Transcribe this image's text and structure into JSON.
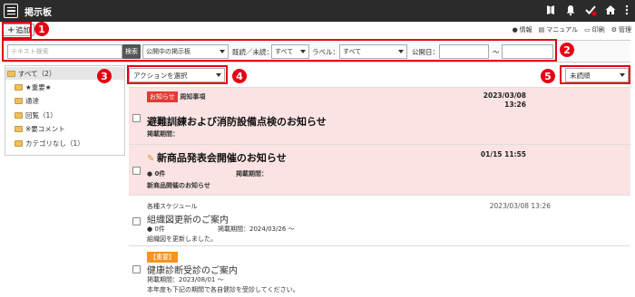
{
  "app": {
    "title": "掲示板"
  },
  "toolbar": {
    "add_label": "追加"
  },
  "links": [
    {
      "label": "情報",
      "icon": "info-icon"
    },
    {
      "label": "マニュアル",
      "icon": "book-icon"
    },
    {
      "label": "印刷",
      "icon": "printer-icon"
    },
    {
      "label": "管理",
      "icon": "gear-icon"
    }
  ],
  "filter": {
    "search_placeholder": "テキスト検索",
    "search_button": "検索",
    "scope": "公開中の掲示板",
    "read_label": "既読／未読：",
    "read_value": "すべて",
    "label_label": "ラベル：",
    "label_value": "すべて",
    "date_label": "公開日：",
    "date_sep": "～"
  },
  "tree": [
    {
      "label": "すべて（2）"
    },
    {
      "label": "★重要★"
    },
    {
      "label": "通達"
    },
    {
      "label": "回覧（1）"
    },
    {
      "label": "※要コメント"
    },
    {
      "label": "カテゴリなし（1）"
    }
  ],
  "action_select": "アクションを選択",
  "sort_select": "未読順",
  "badges": [
    "1",
    "2",
    "3",
    "4",
    "5"
  ],
  "posts": {
    "p1": {
      "tag": "お知らせ",
      "category": "周知事項",
      "date": "2023/03/08",
      "time": "13:26",
      "title": "避難訓練および消防設備点検のお知らせ",
      "period": "掲載期間："
    },
    "p2": {
      "title": "新商品発表会開催のお知らせ",
      "date": "01/15 11:55",
      "comments": "0件",
      "period": "掲載期間：",
      "body": "新商品開催のお知らせ"
    },
    "p3": {
      "category": "各種スケジュール",
      "date": "2023/03/08 13:26",
      "title": "組織図更新のご案内",
      "comments": "0件",
      "period": "掲載期間：2024/03/26 ～",
      "body": "組織図を更新しました。"
    },
    "p4": {
      "tag": "【重要】",
      "title": "健康診断受診のご案内",
      "period": "掲載期間：2023/08/01 ～",
      "body": "本年度も下記の期間で各自健診を受診してください。"
    }
  }
}
